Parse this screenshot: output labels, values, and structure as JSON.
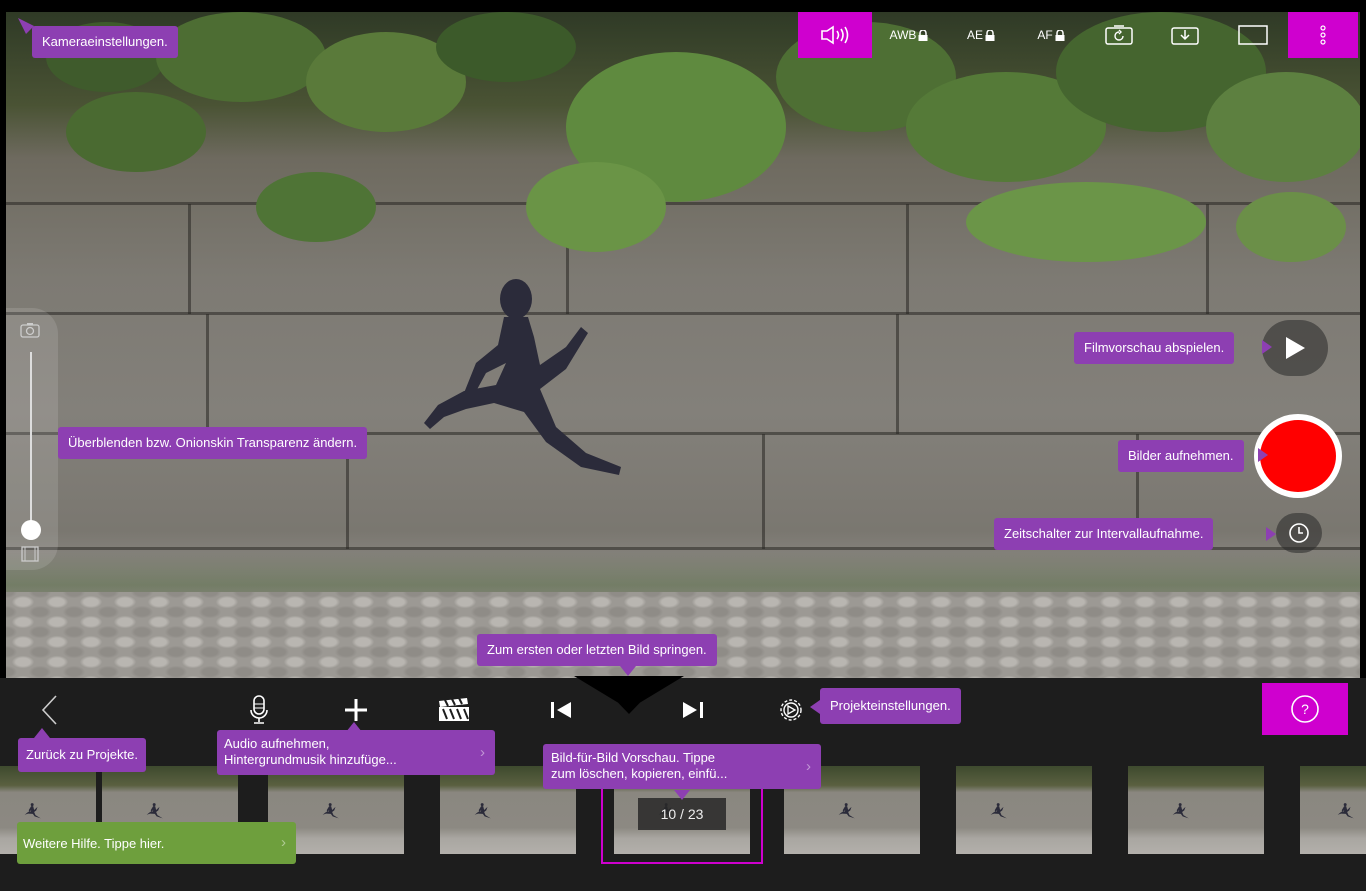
{
  "tooltips": {
    "camera_settings": "Kameraeinstellungen.",
    "onion_skin": "Überblenden bzw. Onionskin Transparenz ändern.",
    "play_preview": "Filmvorschau abspielen.",
    "capture": "Bilder aufnehmen.",
    "interval_timer": "Zeitschalter zur Intervallaufnahme.",
    "jump_first_last": "Zum ersten oder letzten Bild springen.",
    "project_settings": "Projekteinstellungen.",
    "back_to_projects": "Zurück zu Projekte.",
    "audio_line1": "Audio aufnehmen,",
    "audio_line2": "Hintergrundmusik hinzufüge...",
    "frame_preview_line1": "Bild-für-Bild Vorschau. Tippe",
    "frame_preview_line2": "zum löschen, kopieren, einfü...",
    "more_help": "Weitere Hilfe. Tippe hier."
  },
  "camera_toolbar": {
    "awb": "AWB",
    "ae": "AE",
    "af": "AF",
    "icons": [
      "speaker-icon",
      "lock-icon",
      "rotate-camera-icon",
      "import-icon",
      "aspect-frame-icon",
      "more-vertical-icon"
    ]
  },
  "bottom_toolbar": {
    "icons": [
      "back-chevron-icon",
      "microphone-icon",
      "plus-icon",
      "clapperboard-icon",
      "skip-first-icon",
      "skip-last-icon",
      "gear-icon",
      "help-icon"
    ],
    "help": "?"
  },
  "filmstrip": {
    "frame_counter": "10 / 23",
    "current_frame": 10,
    "total_frames": 23
  },
  "colors": {
    "accent": "#cf00cf",
    "tooltip": "#8d3fb2",
    "help_tooltip": "#6e9f3d",
    "record": "#ff0000"
  },
  "onion_skin_level": 0.0
}
